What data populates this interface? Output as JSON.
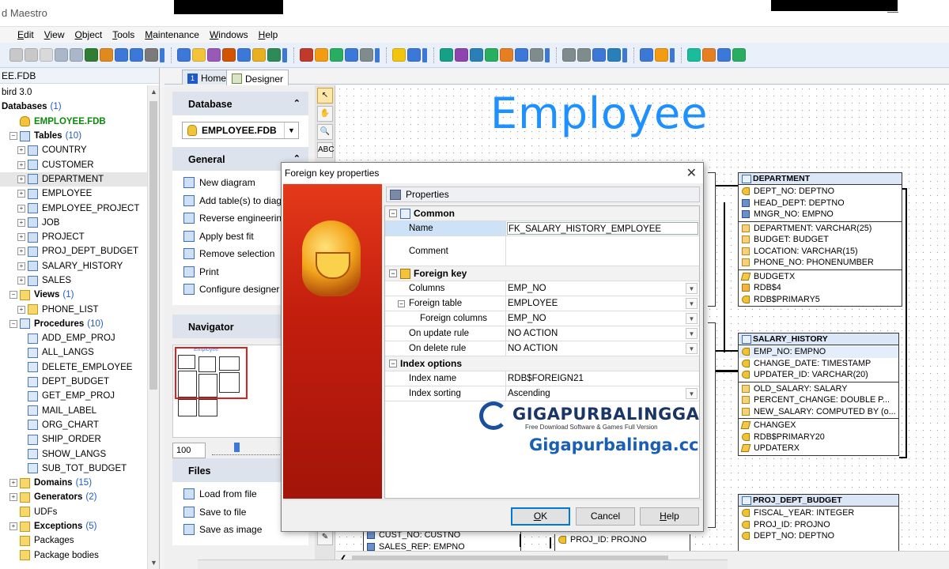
{
  "window": {
    "title": "d Maestro",
    "minimize_glyph": "—"
  },
  "menu": [
    "Edit",
    "View",
    "Object",
    "Tools",
    "Maintenance",
    "Windows",
    "Help"
  ],
  "toolbar": {
    "icon_colors": [
      "#c8c8c8",
      "#c8c8c8",
      "#d9d9d9",
      "#a9b7c9",
      "#a9b7c9",
      "#2f7d32",
      "#e08a1e",
      "#3c78d8",
      "#3c78d8",
      "#7a7a7a",
      "#3c78d8",
      "#f3c33a",
      "#9b59b6",
      "#d35400",
      "#3c78d8",
      "#e8b020",
      "#2e8b57",
      "#c0392b",
      "#f39c12",
      "#27ae60",
      "#3c78d8",
      "#7f8c8d",
      "#f1c40f",
      "#3c78d8",
      "#16a085",
      "#8e44ad",
      "#2980b9",
      "#27ae60",
      "#e67e22",
      "#3c78d8",
      "#7f8c8d",
      "#7f8c8d",
      "#7f8c8d",
      "#3c78d8",
      "#2980b9",
      "#3c78d8",
      "#f39c12",
      "#1abc9c",
      "#e67e22",
      "#3c78d8",
      "#27ae60"
    ]
  },
  "tree": {
    "header": "EE.FDB",
    "nodes": [
      {
        "indent": 0,
        "label": "bird 3.0",
        "icon": "none",
        "exp": ""
      },
      {
        "indent": 0,
        "label": "Databases",
        "count": "(1)",
        "bold": true,
        "icon": "none",
        "exp": ""
      },
      {
        "indent": 1,
        "label": "EMPLOYEE.FDB",
        "green": true,
        "icon": "db",
        "exp": ""
      },
      {
        "indent": 1,
        "label": "Tables",
        "count": "(10)",
        "bold": true,
        "icon": "table",
        "exp": "⊟"
      },
      {
        "indent": 2,
        "label": "COUNTRY",
        "icon": "table",
        "exp": "+"
      },
      {
        "indent": 2,
        "label": "CUSTOMER",
        "icon": "table",
        "exp": "+"
      },
      {
        "indent": 2,
        "label": "DEPARTMENT",
        "icon": "table",
        "exp": "+",
        "selected": true
      },
      {
        "indent": 2,
        "label": "EMPLOYEE",
        "icon": "table",
        "exp": "+"
      },
      {
        "indent": 2,
        "label": "EMPLOYEE_PROJECT",
        "icon": "table",
        "exp": "+"
      },
      {
        "indent": 2,
        "label": "JOB",
        "icon": "table",
        "exp": "+"
      },
      {
        "indent": 2,
        "label": "PROJECT",
        "icon": "table",
        "exp": "+"
      },
      {
        "indent": 2,
        "label": "PROJ_DEPT_BUDGET",
        "icon": "table",
        "exp": "+"
      },
      {
        "indent": 2,
        "label": "SALARY_HISTORY",
        "icon": "table",
        "exp": "+"
      },
      {
        "indent": 2,
        "label": "SALES",
        "icon": "table",
        "exp": "+"
      },
      {
        "indent": 1,
        "label": "Views",
        "count": "(1)",
        "bold": true,
        "icon": "folder",
        "exp": "⊟"
      },
      {
        "indent": 2,
        "label": "PHONE_LIST",
        "icon": "folder",
        "exp": "+"
      },
      {
        "indent": 1,
        "label": "Procedures",
        "count": "(10)",
        "bold": true,
        "icon": "proc",
        "exp": "⊟"
      },
      {
        "indent": 2,
        "label": "ADD_EMP_PROJ",
        "icon": "proc",
        "exp": ""
      },
      {
        "indent": 2,
        "label": "ALL_LANGS",
        "icon": "proc",
        "exp": ""
      },
      {
        "indent": 2,
        "label": "DELETE_EMPLOYEE",
        "icon": "proc",
        "exp": ""
      },
      {
        "indent": 2,
        "label": "DEPT_BUDGET",
        "icon": "proc",
        "exp": ""
      },
      {
        "indent": 2,
        "label": "GET_EMP_PROJ",
        "icon": "proc",
        "exp": ""
      },
      {
        "indent": 2,
        "label": "MAIL_LABEL",
        "icon": "proc",
        "exp": ""
      },
      {
        "indent": 2,
        "label": "ORG_CHART",
        "icon": "proc",
        "exp": ""
      },
      {
        "indent": 2,
        "label": "SHIP_ORDER",
        "icon": "proc",
        "exp": ""
      },
      {
        "indent": 2,
        "label": "SHOW_LANGS",
        "icon": "proc",
        "exp": ""
      },
      {
        "indent": 2,
        "label": "SUB_TOT_BUDGET",
        "icon": "proc",
        "exp": ""
      },
      {
        "indent": 1,
        "label": "Domains",
        "count": "(15)",
        "bold": true,
        "icon": "folder",
        "exp": "+"
      },
      {
        "indent": 1,
        "label": "Generators",
        "count": "(2)",
        "bold": true,
        "icon": "folder",
        "exp": "+"
      },
      {
        "indent": 1,
        "label": "UDFs",
        "icon": "folder",
        "exp": ""
      },
      {
        "indent": 1,
        "label": "Exceptions",
        "count": "(5)",
        "bold": true,
        "icon": "folder",
        "exp": "+"
      },
      {
        "indent": 1,
        "label": "Packages",
        "icon": "folder",
        "exp": ""
      },
      {
        "indent": 1,
        "label": "Package bodies",
        "icon": "folder",
        "exp": ""
      }
    ]
  },
  "tabs": [
    {
      "label": "Home",
      "badge": "1"
    },
    {
      "label": "Designer",
      "badge": ""
    }
  ],
  "side": {
    "database": {
      "title": "Database",
      "combo_value": "EMPLOYEE.FDB"
    },
    "general": {
      "title": "General",
      "items": [
        "New diagram",
        "Add table(s) to diagram",
        "Reverse engineering",
        "Apply best fit",
        "Remove selection",
        "Print",
        "Configure designer"
      ]
    },
    "navigator": {
      "title": "Navigator",
      "mini_title": "Employee",
      "zoom": "100"
    },
    "files": {
      "title": "Files",
      "items": [
        "Load from file",
        "Save to file",
        "Save as image"
      ]
    }
  },
  "designer": {
    "title": "Employee",
    "tools": [
      "↖",
      "✋",
      "🔍",
      "ABC"
    ]
  },
  "entities": {
    "department": {
      "name": "DEPARTMENT",
      "sections": [
        [
          {
            "icon": "key",
            "text": "DEPT_NO: DEPTNO"
          },
          {
            "icon": "fk",
            "text": "HEAD_DEPT: DEPTNO"
          },
          {
            "icon": "fk",
            "text": "MNGR_NO: EMPNO"
          }
        ],
        [
          {
            "icon": "fld",
            "text": "DEPARTMENT: VARCHAR(25)"
          },
          {
            "icon": "fld",
            "text": "BUDGET: BUDGET"
          },
          {
            "icon": "fld",
            "text": "LOCATION: VARCHAR(15)"
          },
          {
            "icon": "fld",
            "text": "PHONE_NO: PHONENUMBER"
          }
        ],
        [
          {
            "icon": "trig",
            "text": "BUDGETX"
          },
          {
            "icon": "ok",
            "text": "RDB$4"
          },
          {
            "icon": "key",
            "text": "RDB$PRIMARY5"
          }
        ]
      ]
    },
    "salary_history": {
      "name": "SALARY_HISTORY",
      "sections": [
        [
          {
            "icon": "key",
            "text": "EMP_NO: EMPNO",
            "hl": true
          },
          {
            "icon": "key",
            "text": "CHANGE_DATE: TIMESTAMP"
          },
          {
            "icon": "key",
            "text": "UPDATER_ID: VARCHAR(20)"
          }
        ],
        [
          {
            "icon": "fld",
            "text": "OLD_SALARY: SALARY"
          },
          {
            "icon": "fld",
            "text": "PERCENT_CHANGE: DOUBLE P..."
          },
          {
            "icon": "fld",
            "text": "NEW_SALARY: COMPUTED BY (o..."
          }
        ],
        [
          {
            "icon": "trig",
            "text": "CHANGEX"
          },
          {
            "icon": "key",
            "text": "RDB$PRIMARY20"
          },
          {
            "icon": "trig",
            "text": "UPDATERX"
          }
        ]
      ]
    },
    "proj_dept_budget": {
      "name": "PROJ_DEPT_BUDGET",
      "sections": [
        [
          {
            "icon": "key",
            "text": "FISCAL_YEAR: INTEGER"
          },
          {
            "icon": "key",
            "text": "PROJ_ID: PROJNO"
          },
          {
            "icon": "key",
            "text": "DEPT_NO: DEPTNO"
          }
        ]
      ]
    },
    "bottom_left_rows": [
      {
        "icon": "fk",
        "text": "CUST_NO: CUSTNO"
      },
      {
        "icon": "fk",
        "text": "SALES_REP: EMPNO"
      }
    ],
    "bottom_mid_rows": [
      {
        "icon": "key",
        "text": "PROJ_ID: PROJNO"
      }
    ]
  },
  "dialog": {
    "title": "Foreign key properties",
    "tab": "Properties",
    "categories": {
      "common": {
        "label": "Common",
        "rows": [
          {
            "name": "Name",
            "value": "FK_SALARY_HISTORY_EMPLOYEE",
            "selected": true,
            "editing": true
          },
          {
            "name": "Comment",
            "value": "",
            "tall": true
          }
        ]
      },
      "foreign_key": {
        "label": "Foreign key",
        "rows": [
          {
            "name": "Columns",
            "value": "EMP_NO",
            "dd": true
          },
          {
            "name": "Foreign table",
            "value": "EMPLOYEE",
            "dd": true,
            "sub": "⊟"
          },
          {
            "name": "Foreign columns",
            "value": "EMP_NO",
            "dd": true,
            "indent": true
          },
          {
            "name": "On update rule",
            "value": "NO ACTION",
            "dd": true
          },
          {
            "name": "On delete rule",
            "value": "NO ACTION",
            "dd": true
          }
        ]
      },
      "index_options": {
        "label": "Index options",
        "rows": [
          {
            "name": "Index name",
            "value": "RDB$FOREIGN21"
          },
          {
            "name": "Index sorting",
            "value": "Ascending",
            "dd": true
          }
        ]
      }
    },
    "buttons": {
      "ok": "OK",
      "cancel": "Cancel",
      "help": "Help"
    },
    "close_glyph": "✕"
  },
  "watermark": {
    "title": "GIGAPURBALINGGA",
    "subtitle": "Free Download Software & Games Full Version",
    "url": "Gigapurbalinga.cc"
  }
}
